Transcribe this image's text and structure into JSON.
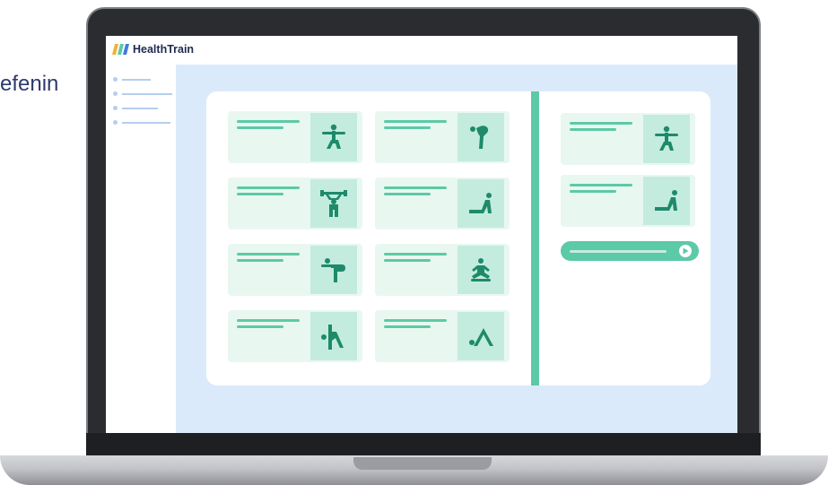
{
  "background_text": "efenin",
  "app": {
    "name": "HealthTrain"
  },
  "colors": {
    "accent": "#5cc9a7",
    "accent_light": "#c3ecde",
    "card_bg": "#e9f7f1",
    "main_bg": "#dbeafa",
    "sidebar_line": "#b5cdf0",
    "logo_text": "#1f2a52",
    "icon": "#1e8a6a"
  },
  "sidebar": {
    "items": [
      {
        "icon": "bullet-dot"
      },
      {
        "icon": "bullet-dot"
      },
      {
        "icon": "bullet-dot"
      },
      {
        "icon": "bullet-dot"
      }
    ]
  },
  "exercises": [
    {
      "icon": "warrior-pose-icon"
    },
    {
      "icon": "kick-stretch-icon"
    },
    {
      "icon": "weightlifting-icon"
    },
    {
      "icon": "floor-stretch-icon"
    },
    {
      "icon": "standing-stretch-icon"
    },
    {
      "icon": "meditation-icon"
    },
    {
      "icon": "push-up-icon"
    },
    {
      "icon": "downward-dog-icon"
    }
  ],
  "selected": [
    {
      "icon": "warrior-pose-icon"
    },
    {
      "icon": "floor-stretch-icon"
    }
  ],
  "player": {
    "icon": "play-icon"
  }
}
